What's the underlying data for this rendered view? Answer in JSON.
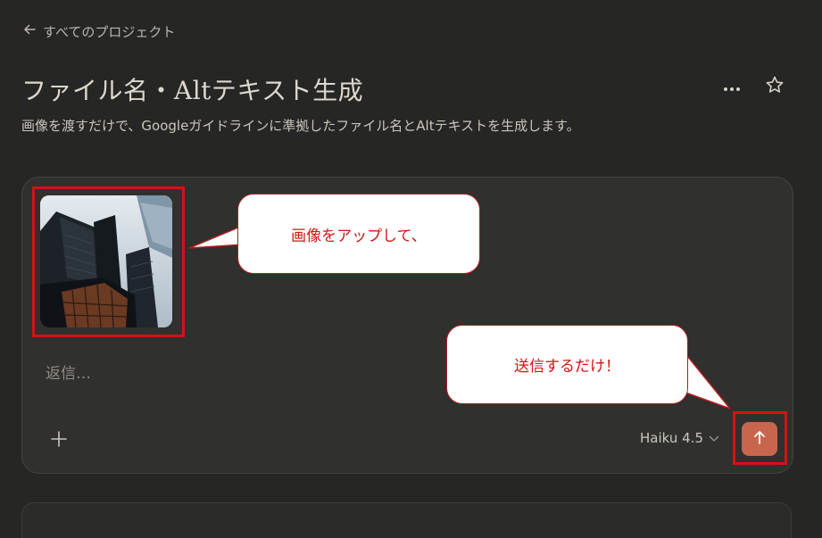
{
  "nav": {
    "back_label": "すべてのプロジェクト"
  },
  "project": {
    "title": "ファイル名・Altテキスト生成",
    "description": "画像を渡すだけで、Googleガイドラインに準拠したファイル名とAltテキストを生成します。"
  },
  "composer": {
    "placeholder": "返信…",
    "model_label": "Haiku 4.5",
    "attachment_alt": "高層ビル群を見上げた写真"
  },
  "annotations": {
    "upload_note": "画像をアップして、",
    "send_note": "送信するだけ！"
  },
  "colors": {
    "background": "#262624",
    "composer": "#30302e",
    "send_button": "#c8664d",
    "highlight": "#d21414"
  }
}
